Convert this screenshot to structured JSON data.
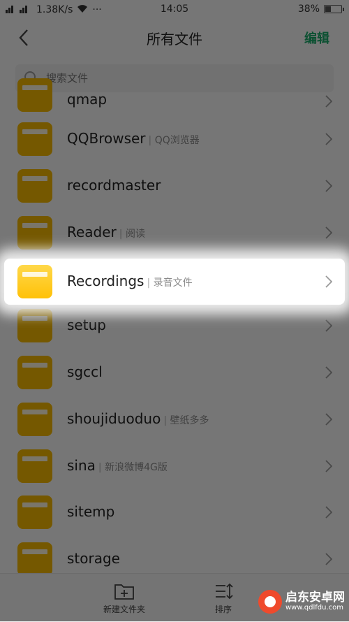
{
  "status_bar": {
    "signal_left": "ⵂıl ⵂıl",
    "speed": "1.38K/s",
    "wifi_icon": "wifi-icon",
    "dots": "···",
    "time": "14:05",
    "battery_pct": "38%",
    "battery_level": 0.38
  },
  "nav": {
    "title": "所有文件",
    "edit_label": "编辑"
  },
  "search": {
    "placeholder": "搜索文件"
  },
  "files": [
    {
      "name": "qmap",
      "note": ""
    },
    {
      "name": "QQBrowser",
      "note": "QQ浏览器"
    },
    {
      "name": "recordmaster",
      "note": ""
    },
    {
      "name": "Reader",
      "note": "阅读"
    },
    {
      "name": "Recordings",
      "note": "录音文件"
    },
    {
      "name": "setup",
      "note": ""
    },
    {
      "name": "sgccl",
      "note": ""
    },
    {
      "name": "shoujiduoduo",
      "note": "壁纸多多"
    },
    {
      "name": "sina",
      "note": "新浪微博4G版"
    },
    {
      "name": "sitemp",
      "note": ""
    },
    {
      "name": "storage",
      "note": ""
    }
  ],
  "bottom_bar": {
    "new_folder_label": "新建文件夹",
    "sort_label": "排序"
  },
  "watermark": {
    "title": "启东安卓网",
    "url": "www.qdlfdu.com"
  },
  "colors": {
    "accent_green": "#1aa96a",
    "folder_yellow": "#f5b800"
  }
}
